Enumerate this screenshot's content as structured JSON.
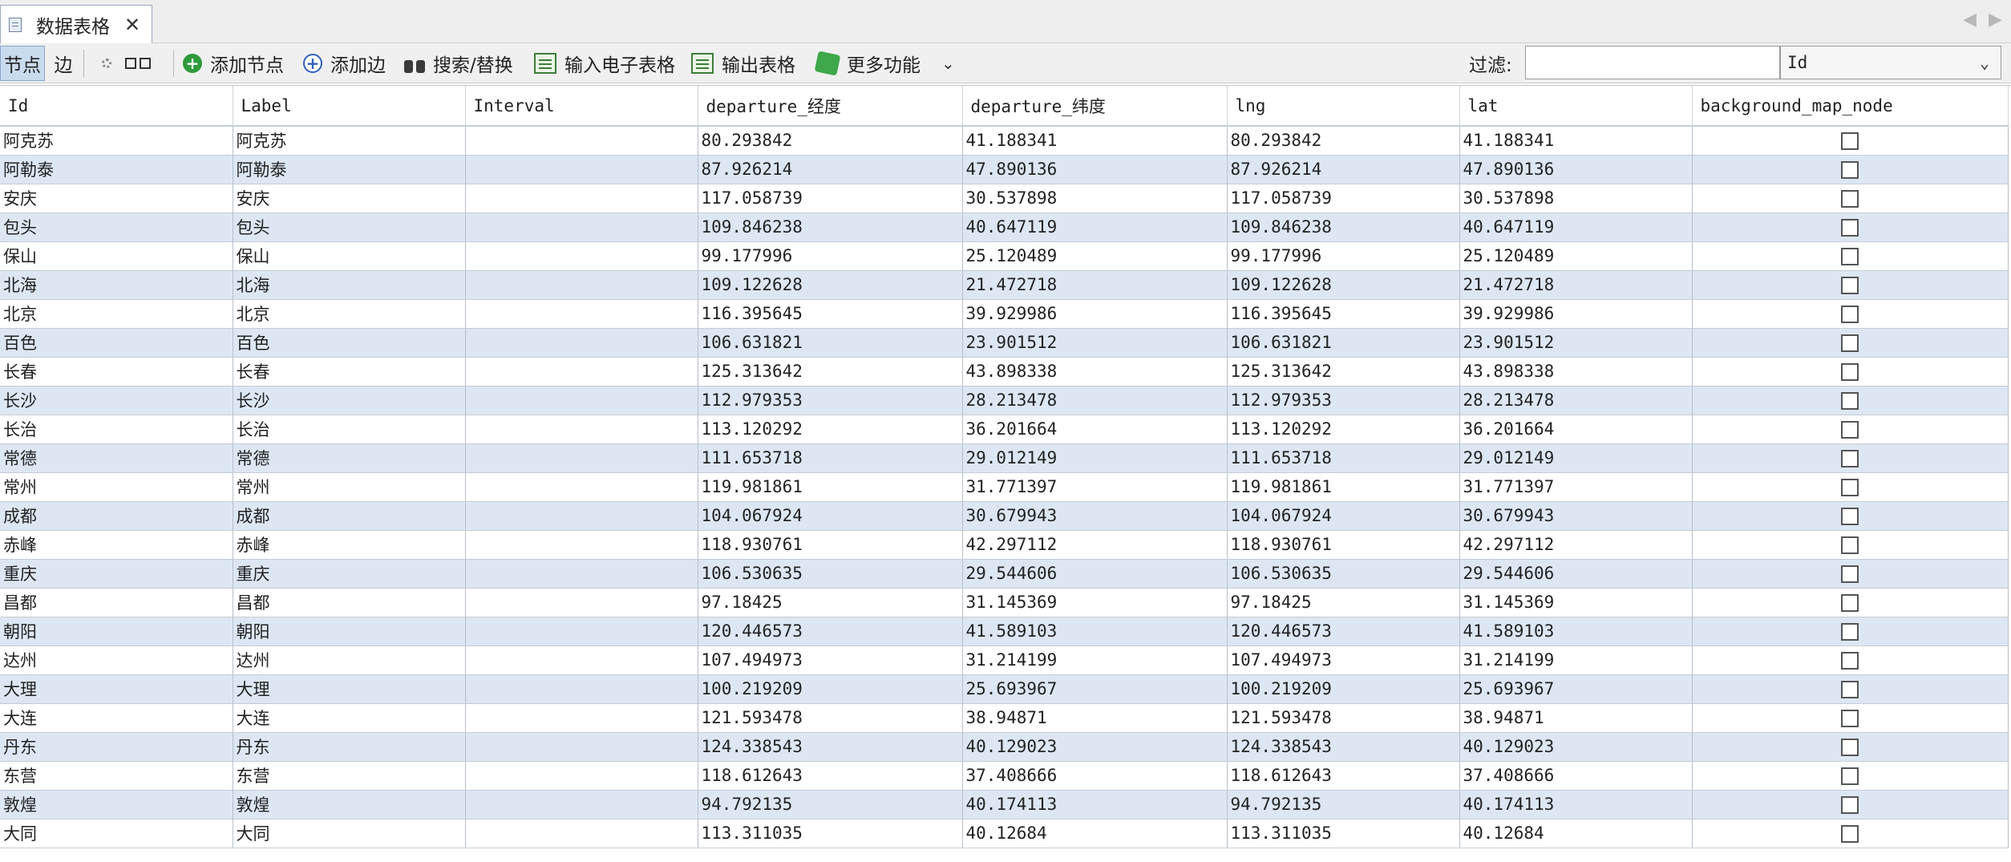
{
  "tab": {
    "label": "数据表格",
    "close": "✕"
  },
  "nav": {
    "left": "◀",
    "right": "▶"
  },
  "toolbar": {
    "node_tab": "节点",
    "edge_tab": "边",
    "add_node": "添加节点",
    "add_edge": "添加边",
    "search_replace": "搜索/替换",
    "import_spreadsheet": "输入电子表格",
    "export_table": "输出表格",
    "more_functions": "更多功能",
    "dropdown_arrow": "⌄",
    "filter_label": "过滤:",
    "filter_value": "",
    "column_select": "Id",
    "column_select_arrow": "⌄"
  },
  "table": {
    "columns": [
      "Id",
      "Label",
      "Interval",
      "departure_经度",
      "departure_纬度",
      "lng",
      "lat",
      "background_map_node"
    ],
    "rows": [
      [
        "阿克苏",
        "阿克苏",
        "",
        "80.293842",
        "41.188341",
        "80.293842",
        "41.188341"
      ],
      [
        "阿勒泰",
        "阿勒泰",
        "",
        "87.926214",
        "47.890136",
        "87.926214",
        "47.890136"
      ],
      [
        "安庆",
        "安庆",
        "",
        "117.058739",
        "30.537898",
        "117.058739",
        "30.537898"
      ],
      [
        "包头",
        "包头",
        "",
        "109.846238",
        "40.647119",
        "109.846238",
        "40.647119"
      ],
      [
        "保山",
        "保山",
        "",
        "99.177996",
        "25.120489",
        "99.177996",
        "25.120489"
      ],
      [
        "北海",
        "北海",
        "",
        "109.122628",
        "21.472718",
        "109.122628",
        "21.472718"
      ],
      [
        "北京",
        "北京",
        "",
        "116.395645",
        "39.929986",
        "116.395645",
        "39.929986"
      ],
      [
        "百色",
        "百色",
        "",
        "106.631821",
        "23.901512",
        "106.631821",
        "23.901512"
      ],
      [
        "长春",
        "长春",
        "",
        "125.313642",
        "43.898338",
        "125.313642",
        "43.898338"
      ],
      [
        "长沙",
        "长沙",
        "",
        "112.979353",
        "28.213478",
        "112.979353",
        "28.213478"
      ],
      [
        "长治",
        "长治",
        "",
        "113.120292",
        "36.201664",
        "113.120292",
        "36.201664"
      ],
      [
        "常德",
        "常德",
        "",
        "111.653718",
        "29.012149",
        "111.653718",
        "29.012149"
      ],
      [
        "常州",
        "常州",
        "",
        "119.981861",
        "31.771397",
        "119.981861",
        "31.771397"
      ],
      [
        "成都",
        "成都",
        "",
        "104.067924",
        "30.679943",
        "104.067924",
        "30.679943"
      ],
      [
        "赤峰",
        "赤峰",
        "",
        "118.930761",
        "42.297112",
        "118.930761",
        "42.297112"
      ],
      [
        "重庆",
        "重庆",
        "",
        "106.530635",
        "29.544606",
        "106.530635",
        "29.544606"
      ],
      [
        "昌都",
        "昌都",
        "",
        "97.18425",
        "31.145369",
        "97.18425",
        "31.145369"
      ],
      [
        "朝阳",
        "朝阳",
        "",
        "120.446573",
        "41.589103",
        "120.446573",
        "41.589103"
      ],
      [
        "达州",
        "达州",
        "",
        "107.494973",
        "31.214199",
        "107.494973",
        "31.214199"
      ],
      [
        "大理",
        "大理",
        "",
        "100.219209",
        "25.693967",
        "100.219209",
        "25.693967"
      ],
      [
        "大连",
        "大连",
        "",
        "121.593478",
        "38.94871",
        "121.593478",
        "38.94871"
      ],
      [
        "丹东",
        "丹东",
        "",
        "124.338543",
        "40.129023",
        "124.338543",
        "40.129023"
      ],
      [
        "东营",
        "东营",
        "",
        "118.612643",
        "37.408666",
        "118.612643",
        "37.408666"
      ],
      [
        "敦煌",
        "敦煌",
        "",
        "94.792135",
        "40.174113",
        "94.792135",
        "40.174113"
      ],
      [
        "大同",
        "大同",
        "",
        "113.311035",
        "40.12684",
        "113.311035",
        "40.12684"
      ]
    ]
  }
}
